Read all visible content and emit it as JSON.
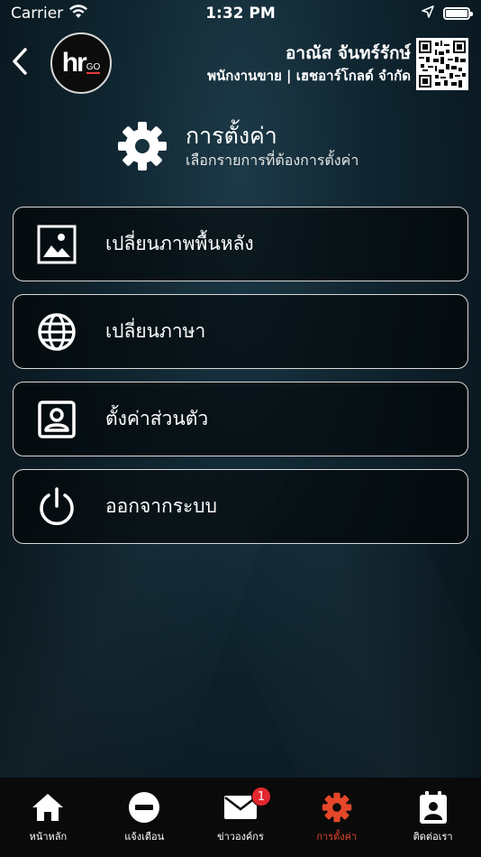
{
  "status_bar": {
    "carrier": "Carrier",
    "time": "1:32 PM",
    "battery_level": 1.0
  },
  "header": {
    "back_icon": "chevron-left-icon",
    "logo_text_main": "hr",
    "logo_text_sub": "GO",
    "user_name": "อาณัส จันทร์รักษ์",
    "user_role": "พนักงานขาย | เฮชอาร์โกลด์ จำกัด",
    "qr_icon": "qr-code-icon"
  },
  "page": {
    "title": "การตั้งค่า",
    "subtitle": "เลือกรายการที่ต้องการตั้งค่า",
    "title_icon": "gear-icon"
  },
  "menu": [
    {
      "label": "เปลี่ยนภาพพื้นหลัง",
      "icon": "image-icon"
    },
    {
      "label": "เปลี่ยนภาษา",
      "icon": "globe-icon"
    },
    {
      "label": "ตั้งค่าส่วนตัว",
      "icon": "profile-card-icon"
    },
    {
      "label": "ออกจากระบบ",
      "icon": "power-icon"
    }
  ],
  "tabs": [
    {
      "label": "หน้าหลัก",
      "icon": "home-icon"
    },
    {
      "label": "แจ้งเตือน",
      "icon": "minus-circle-icon"
    },
    {
      "label": "ข่าวองค์กร",
      "icon": "mail-icon",
      "badge": "1"
    },
    {
      "label": "การตั้งค่า",
      "icon": "gear-icon",
      "active": true
    },
    {
      "label": "ติดต่อเรา",
      "icon": "contact-icon"
    }
  ],
  "colors": {
    "accent": "#e4472a",
    "badge": "#e4272f",
    "background": "#0f2530",
    "tab_bar": "#0a0a0a"
  }
}
